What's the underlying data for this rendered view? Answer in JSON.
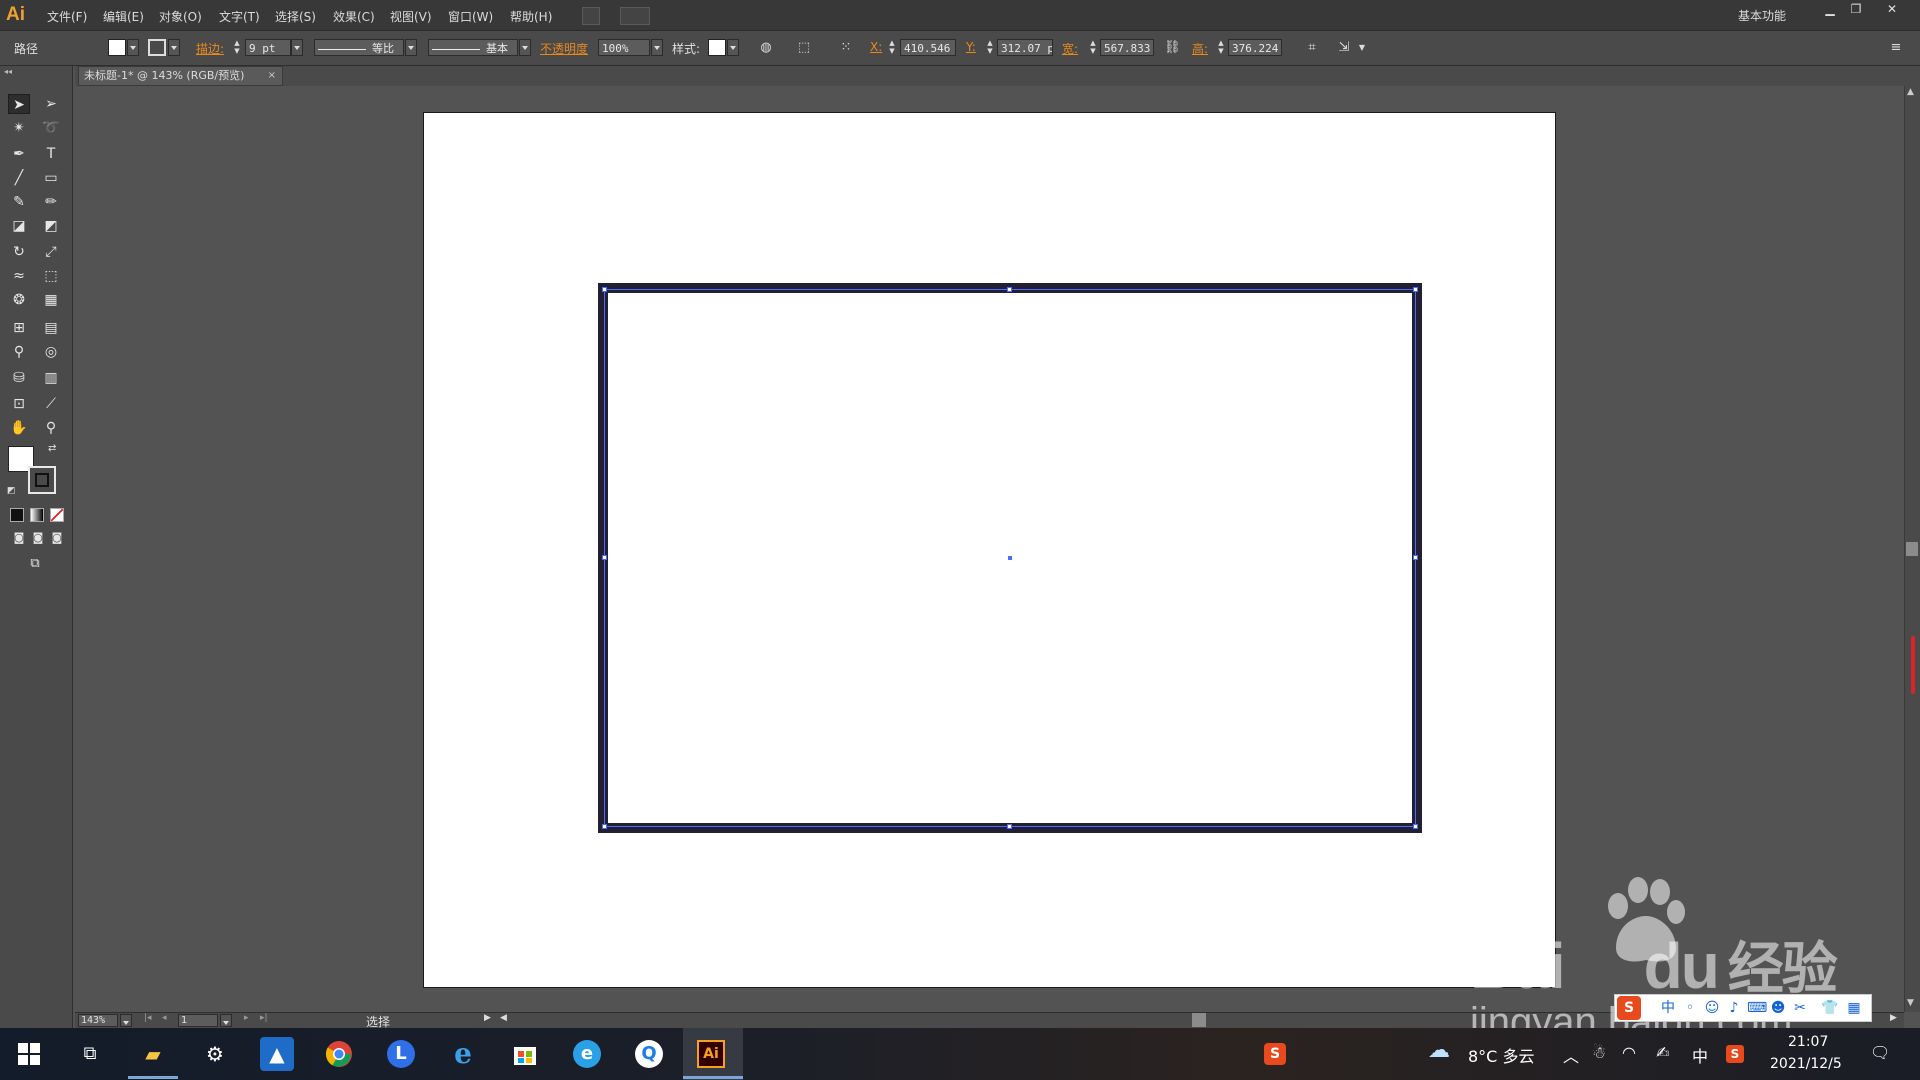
{
  "app": {
    "logo": "Ai"
  },
  "menu": {
    "items": [
      "文件(F)",
      "编辑(E)",
      "对象(O)",
      "文字(T)",
      "选择(S)",
      "效果(C)",
      "视图(V)",
      "窗口(W)",
      "帮助(H)"
    ],
    "workspace": "基本功能",
    "window_controls": {
      "minimize": "▁",
      "restore": "❐",
      "close": "✕"
    }
  },
  "control_bar": {
    "object_type": "路径",
    "stroke_label": "描边:",
    "stroke_weight": "9 pt",
    "stroke_profile": "等比",
    "brush": "基本",
    "opacity_label": "不透明度",
    "opacity": "100%",
    "style_label": "样式:",
    "x_label": "X:",
    "x": "410.546",
    "y_label": "Y:",
    "y": "312.07 p",
    "w_label": "宽:",
    "w": "567.833",
    "h_label": "高:",
    "h": "376.224"
  },
  "document_tab": {
    "title": "未标题-1* @ 143% (RGB/预览)",
    "close": "×"
  },
  "status_bar": {
    "zoom": "143%",
    "artboard": "1",
    "tool": "选择"
  },
  "watermark": {
    "baidu": "Bai",
    "du": "du",
    "brand": "经验",
    "url": "jingyan.baidu.com"
  },
  "taskbar": {
    "weather": "8°C 多云",
    "ime": "中",
    "time": "21:07",
    "date": "2021/12/5",
    "active_app_label": "Ai"
  },
  "colors": {
    "stroke": "#231f33",
    "selection": "#4a6cff",
    "accent_orange": "#e8891c"
  }
}
